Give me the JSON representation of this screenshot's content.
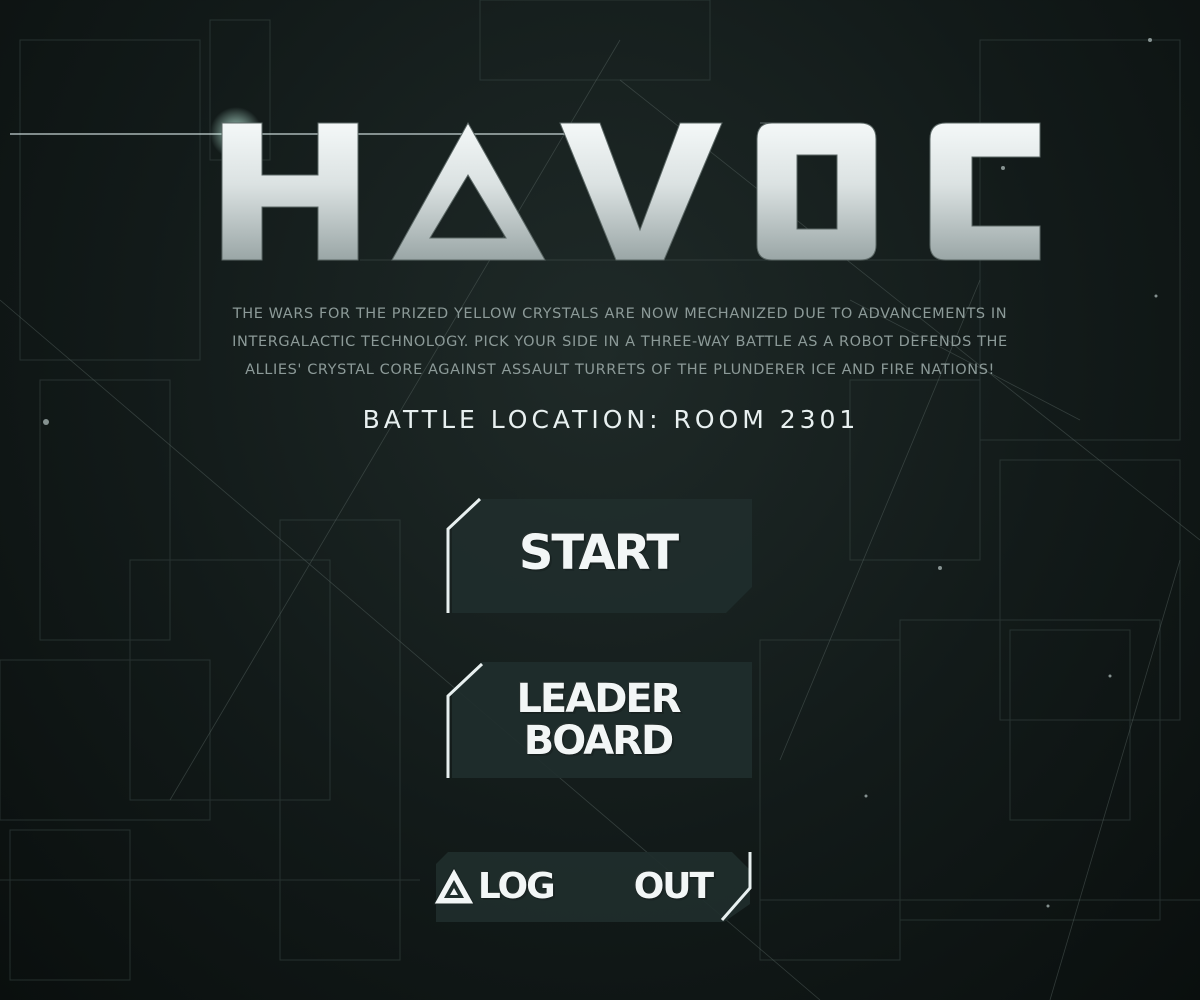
{
  "game": {
    "title": "HAVOC",
    "story_lines": [
      "THE WARS FOR THE PRIZED YELLOW CRYSTALS ARE NOW MECHANIZED DUE TO ADVANCEMENTS IN",
      "INTERGALACTIC TECHNOLOGY. PICK YOUR SIDE IN A THREE-WAY BATTLE AS A ROBOT DEFENDS THE",
      "ALLIES' CRYSTAL CORE AGAINST ASSAULT TURRETS OF THE PLUNDERER ICE AND FIRE NATIONS!"
    ],
    "battle_location": "BATTLE LOCATION: ROOM 2301"
  },
  "menu": {
    "start_label": "START",
    "leaderboard_line1": "LEADER",
    "leaderboard_line2": "BOARD",
    "logout_left": "LOG",
    "logout_right": "OUT",
    "logout_icon": "triangle-icon"
  },
  "colors": {
    "background": "#121a19",
    "button_fill": "#1f2e2c",
    "accent": "#e8f0f0"
  }
}
